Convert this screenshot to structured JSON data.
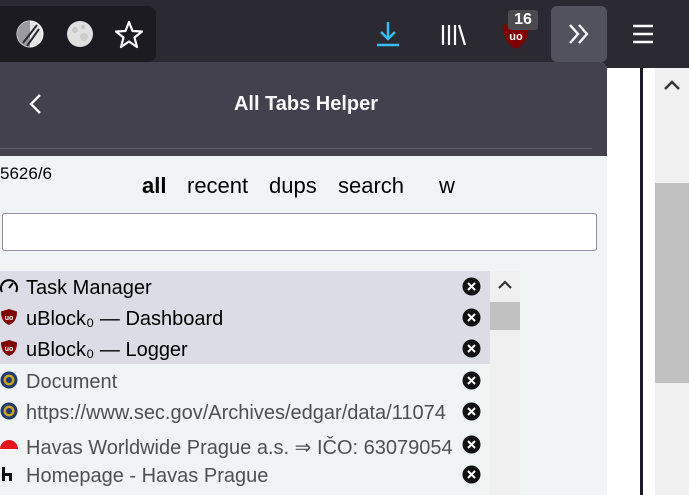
{
  "toolbar": {
    "icons": [
      "privacy-mask-icon",
      "moon-globe-icon",
      "star-bookmark-icon",
      "download-icon",
      "library-icon",
      "ublock-icon",
      "overflow-chevrons-icon",
      "hamburger-menu-icon"
    ],
    "ublock_badge": "16",
    "accent_color": "#38bdf8"
  },
  "panel": {
    "title": "All Tabs Helper",
    "count": "5626/6",
    "nav": {
      "all": "all",
      "recent": "recent",
      "dups": "dups",
      "search": "search",
      "w": "w"
    },
    "search_value": "",
    "tabs": [
      {
        "title": "Task Manager",
        "icon": "gauge-icon",
        "selected": true
      },
      {
        "title": "uBlock₀ — Dashboard",
        "icon": "ublock-shield-icon",
        "selected": true
      },
      {
        "title": "uBlock₀ — Logger",
        "icon": "ublock-shield-icon",
        "selected": true
      },
      {
        "title": "Document",
        "icon": "sec-seal-icon",
        "selected": false
      },
      {
        "title": "https://www.sec.gov/Archives/edgar/data/11074",
        "icon": "sec-seal-icon",
        "selected": false
      },
      {
        "title": "Havas Worldwide Prague a.s. ⇒ IČO: 63079054",
        "icon": "red-dome-icon",
        "selected": false
      },
      {
        "title": "Homepage - Havas Prague",
        "icon": "havas-h-icon",
        "selected": false
      }
    ]
  }
}
